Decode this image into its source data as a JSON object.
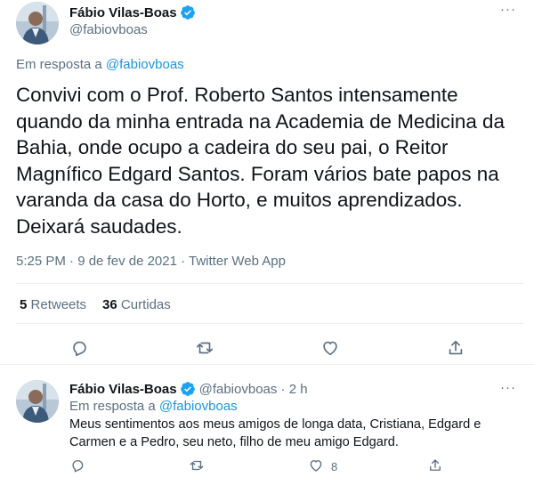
{
  "main_tweet": {
    "display_name": "Fábio Vilas-Boas",
    "handle": "@fabiovboas",
    "more": "···",
    "reply_prefix": "Em resposta a",
    "reply_handle": "@fabiovboas",
    "text": "Convivi com o Prof. Roberto Santos intensamente quando da minha entrada na Academia de Medicina da Bahia, onde ocupo a cadeira do seu pai, o Reitor Magnífico Edgard Santos. Foram vários bate papos na varanda da casa do Horto, e muitos aprendizados. Deixará saudades.",
    "timestamp": "5:25 PM · 9 de fev de 2021 · ",
    "source": "Twitter Web App",
    "retweets_count": "5",
    "retweets_label": "Retweets",
    "likes_count": "36",
    "likes_label": "Curtidas",
    "actions": [
      "reply-icon",
      "retweet-icon",
      "like-icon",
      "share-icon"
    ]
  },
  "reply_tweet": {
    "display_name": "Fábio Vilas-Boas",
    "handle_time": "@fabiovboas · 2 h",
    "more": "···",
    "reply_prefix": "Em resposta a",
    "reply_handle": "@fabiovboas",
    "text": "Meus sentimentos aos meus amigos de longa data, Cristiana, Edgard e Carmen e a Pedro, seu neto, filho de meu amigo Edgard.",
    "like_count": "8",
    "actions": [
      "reply-icon",
      "retweet-icon",
      "like-icon",
      "share-icon"
    ]
  },
  "colors": {
    "text": "#0f1419",
    "secondary": "#5b7083",
    "link": "#1b95e0",
    "verified": "#1da1f2",
    "divider": "#ebeef0"
  }
}
